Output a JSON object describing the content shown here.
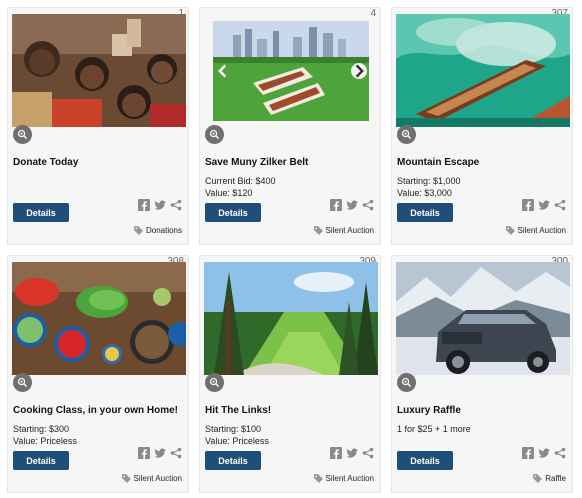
{
  "cards": [
    {
      "number": "1",
      "title": "Donate Today",
      "line1": "",
      "line2": "",
      "button": "Details",
      "category": "Donations",
      "image_icon": "children-photo"
    },
    {
      "number": "4",
      "title": "Save Muny Zilker Belt",
      "line1": "Current Bid: $400",
      "line2": "Value: $120",
      "button": "Details",
      "category": "Silent Auction",
      "image_icon": "belt-photo"
    },
    {
      "number": "307",
      "title": "Mountain Escape",
      "line1": "Starting: $1,000",
      "line2": "Value: $3,000",
      "button": "Details",
      "category": "Silent Auction",
      "image_icon": "boat-lake-photo"
    },
    {
      "number": "308",
      "title": "Cooking Class, in your own Home!",
      "line1": "Starting: $300",
      "line2": "Value: Priceless",
      "button": "Details",
      "category": "Silent Auction",
      "image_icon": "cooking-photo"
    },
    {
      "number": "309",
      "title": "Hit The Links!",
      "line1": "Starting: $100",
      "line2": "Value: Priceless",
      "button": "Details",
      "category": "Silent Auction",
      "image_icon": "golf-course-photo"
    },
    {
      "number": "300",
      "title": "Luxury Raffle",
      "line1": "1 for $25 + 1 more",
      "line2": "",
      "button": "Details",
      "category": "Raffle",
      "image_icon": "jeep-photo"
    }
  ],
  "colors": {
    "button": "#1f4e79",
    "card_bg": "#f6f6f6",
    "zoom_bg": "#6f6f6f",
    "icon_gray": "#888888"
  }
}
